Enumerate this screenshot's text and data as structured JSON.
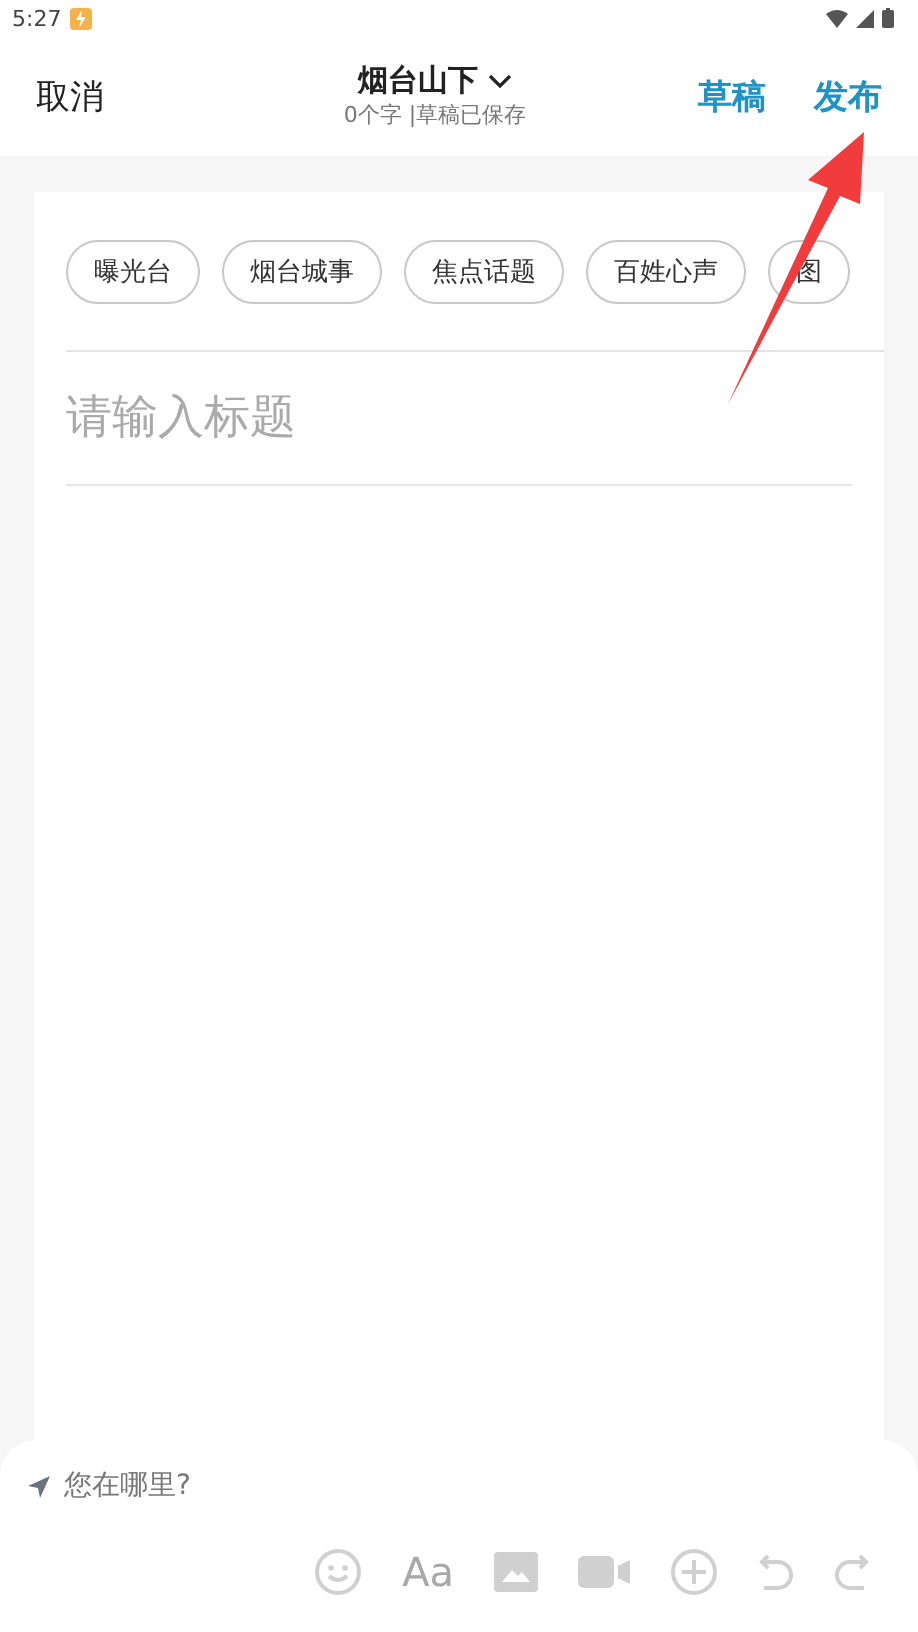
{
  "status_bar": {
    "time": "5:27"
  },
  "header": {
    "cancel": "取消",
    "title": "烟台山下",
    "subtitle": "0个字 |草稿已保存",
    "draft": "草稿",
    "publish": "发布"
  },
  "topics": [
    {
      "label": "曝光台"
    },
    {
      "label": "烟台城事"
    },
    {
      "label": "焦点话题"
    },
    {
      "label": "百姓心声"
    },
    {
      "label": "图"
    }
  ],
  "title_field": {
    "placeholder": "请输入标题"
  },
  "location": {
    "label": "您在哪里?"
  },
  "toolbar": [
    {
      "kind": "emoji"
    },
    {
      "kind": "text",
      "label": "Aa"
    },
    {
      "kind": "image"
    },
    {
      "kind": "video"
    },
    {
      "kind": "add"
    },
    {
      "kind": "undo"
    },
    {
      "kind": "redo"
    }
  ]
}
